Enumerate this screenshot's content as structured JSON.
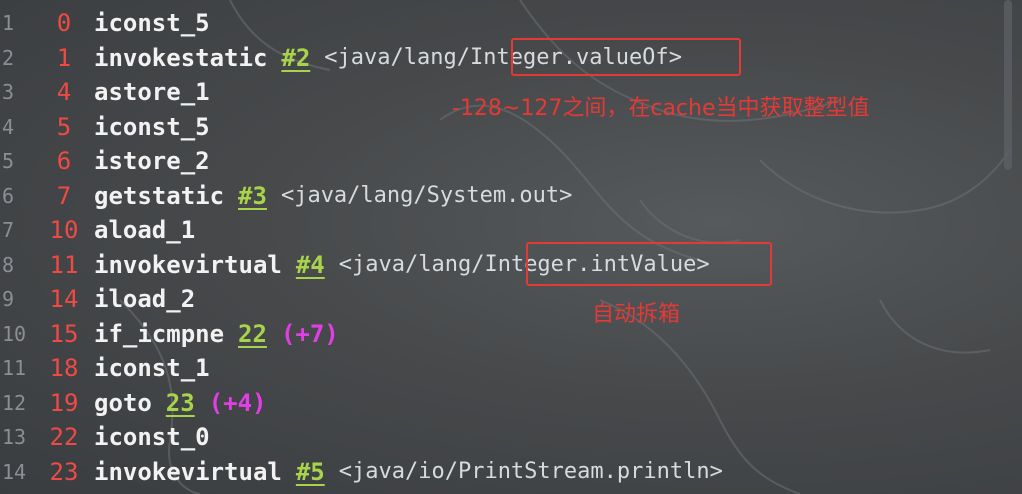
{
  "lines": [
    {
      "ln": "1",
      "offset": "0",
      "op": "iconst_5"
    },
    {
      "ln": "2",
      "offset": "1",
      "op": "invokestatic",
      "ref": "#2",
      "pre": "<java/lang/",
      "target": "Integer.valueOf",
      "post": ">"
    },
    {
      "ln": "3",
      "offset": "4",
      "op": "astore_1"
    },
    {
      "ln": "4",
      "offset": "5",
      "op": "iconst_5"
    },
    {
      "ln": "5",
      "offset": "6",
      "op": "istore_2"
    },
    {
      "ln": "6",
      "offset": "7",
      "op": "getstatic",
      "ref": "#3",
      "arg": "<java/lang/System.out>"
    },
    {
      "ln": "7",
      "offset": "10",
      "op": "aload_1"
    },
    {
      "ln": "8",
      "offset": "11",
      "op": "invokevirtual",
      "ref": "#4",
      "pre": "<java/lang/",
      "target": "Integer.intValue",
      "post": ">"
    },
    {
      "ln": "9",
      "offset": "14",
      "op": "iload_2"
    },
    {
      "ln": "10",
      "offset": "15",
      "op": "if_icmpne",
      "ref": "22",
      "jump": "(+7)"
    },
    {
      "ln": "11",
      "offset": "18",
      "op": "iconst_1"
    },
    {
      "ln": "12",
      "offset": "19",
      "op": "goto",
      "ref": "23",
      "jump": "(+4)"
    },
    {
      "ln": "13",
      "offset": "22",
      "op": "iconst_0"
    },
    {
      "ln": "14",
      "offset": "23",
      "op": "invokevirtual",
      "ref": "#5",
      "arg": "<java/io/PrintStream.println>"
    }
  ],
  "annotations": {
    "note1": "-128~127之间，在cache当中获取整型值",
    "note2": "自动拆箱"
  },
  "colors": {
    "offset": "#f04a44",
    "ref": "#a7d44a",
    "jump": "#e23ee6",
    "annotation": "#e53935"
  }
}
